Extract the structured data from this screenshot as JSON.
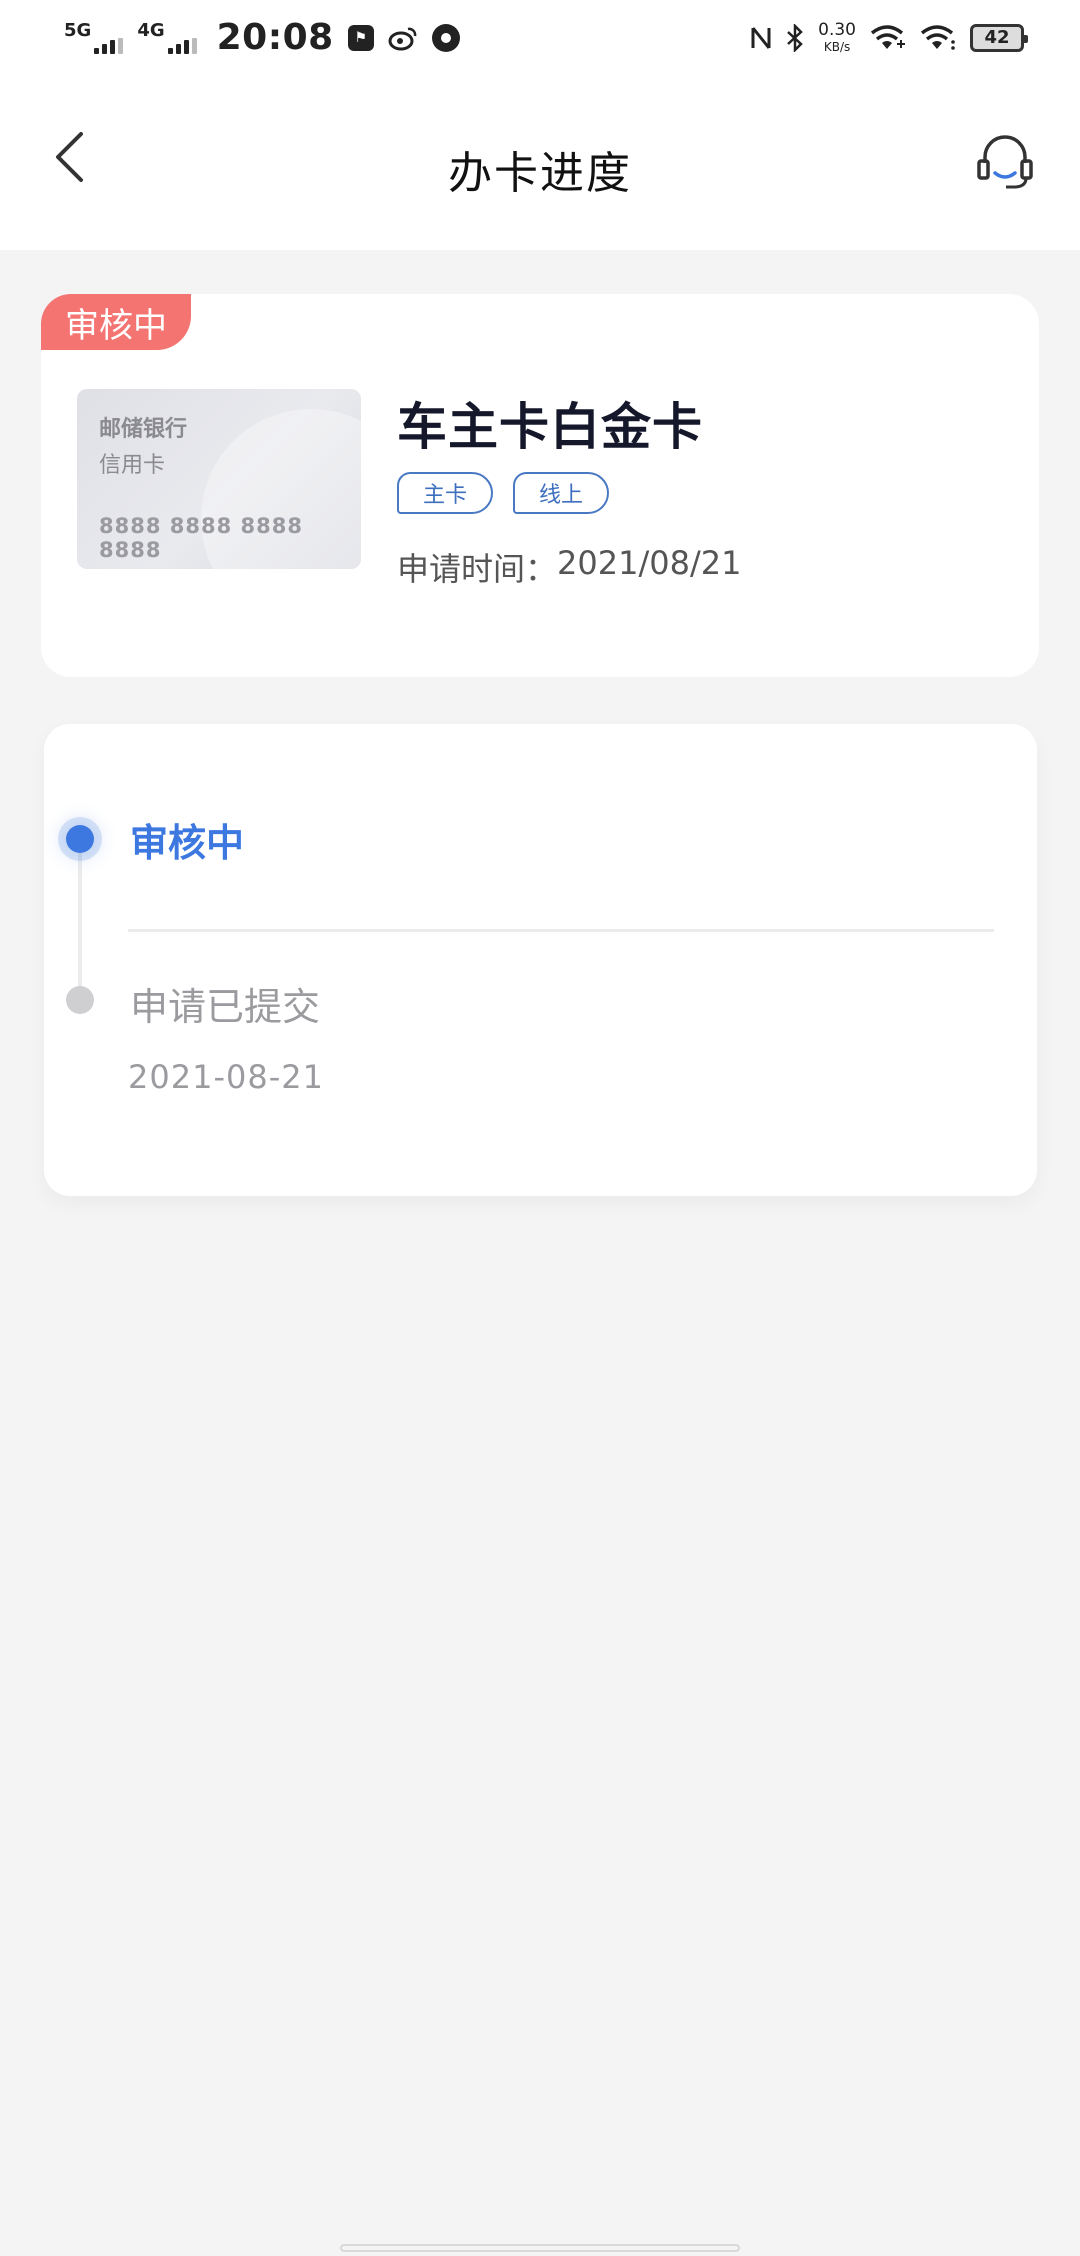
{
  "status_bar": {
    "net1": "5G",
    "net2": "4G",
    "time": "20:08",
    "speed_value": "0.30",
    "speed_unit": "KB/s",
    "battery": "42"
  },
  "nav": {
    "title": "办卡进度"
  },
  "card": {
    "status_ribbon": "审核中",
    "image_bank": "邮储银行",
    "image_type": "信用卡",
    "image_number": "8888 8888 8888 8888",
    "name": "车主卡白金卡",
    "tags": [
      "主卡",
      "线上"
    ],
    "apply_label": "申请时间：",
    "apply_date": "2021/08/21"
  },
  "progress": {
    "steps": [
      {
        "title": "审核中",
        "state": "active"
      },
      {
        "title": "申请已提交",
        "date": "2021-08-21",
        "state": "done"
      }
    ]
  },
  "colors": {
    "accent": "#3c78e0",
    "ribbon": "#f47471",
    "tag": "#4a79c4"
  }
}
